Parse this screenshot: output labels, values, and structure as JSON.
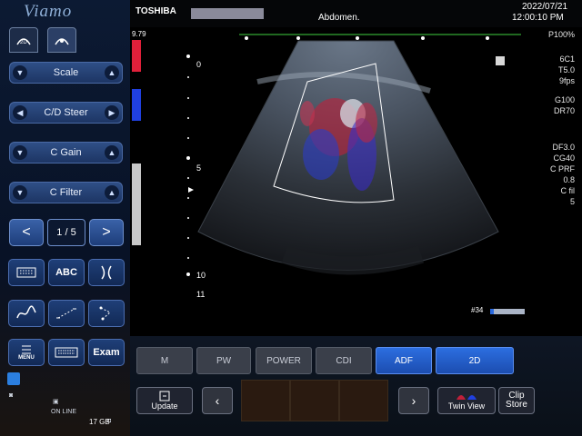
{
  "sidebar": {
    "brand": "Viamo",
    "probe_tabs": [
      "2D",
      "3D"
    ],
    "controls": [
      {
        "label": "Scale",
        "type": "updown"
      },
      {
        "label": "C/D Steer",
        "type": "leftright"
      },
      {
        "label": "C Gain",
        "type": "updown"
      },
      {
        "label": "C Filter",
        "type": "updown"
      }
    ],
    "pager": {
      "prev": "<",
      "page": "1 / 5",
      "next": ">"
    },
    "tools_row1": [
      "keyboard-icon",
      "ABC",
      "body-mark-icon"
    ],
    "tools_row2": [
      "trace-icon",
      "caliper-icon",
      "stretch-icon"
    ],
    "tools_row3": {
      "menu": "MENU",
      "keyboard": "keyboard-icon",
      "exam": "Exam"
    },
    "storage_icons": [
      "camera-icon",
      "video-icon",
      "disk-icon"
    ],
    "storage_text": "17 GB",
    "status_small": "ON LINE"
  },
  "header": {
    "brand": "TOSHIBA",
    "preset": "Abdomen.",
    "date": "2022/07/21",
    "time": "12:00:10 PM"
  },
  "image": {
    "velocity_scale_top": "9.79",
    "depth_marks": [
      "0",
      "5",
      "10",
      "11"
    ],
    "frame_counter": "#34"
  },
  "readouts": [
    "P100%",
    "6C1",
    "T5.0",
    "9fps",
    "G100",
    "DR70",
    "DF3.0",
    "CG40",
    "C PRF",
    "0.8",
    "C fil",
    "5"
  ],
  "modes": [
    {
      "label": "M",
      "active": false
    },
    {
      "label": "PW",
      "active": false
    },
    {
      "label": "POWER",
      "active": false
    },
    {
      "label": "CDI",
      "active": false
    },
    {
      "label": "ADF",
      "active": true
    },
    {
      "label": "2D",
      "active": true
    }
  ],
  "bottom": {
    "update": "Update",
    "twin_view": "Twin View",
    "clip_store_1": "Clip",
    "clip_store_2": "Store"
  },
  "colors": {
    "accent": "#2c6ee0",
    "panel": "#1d3564",
    "doppler_red": "#e0203a",
    "doppler_blue": "#2040e0"
  }
}
